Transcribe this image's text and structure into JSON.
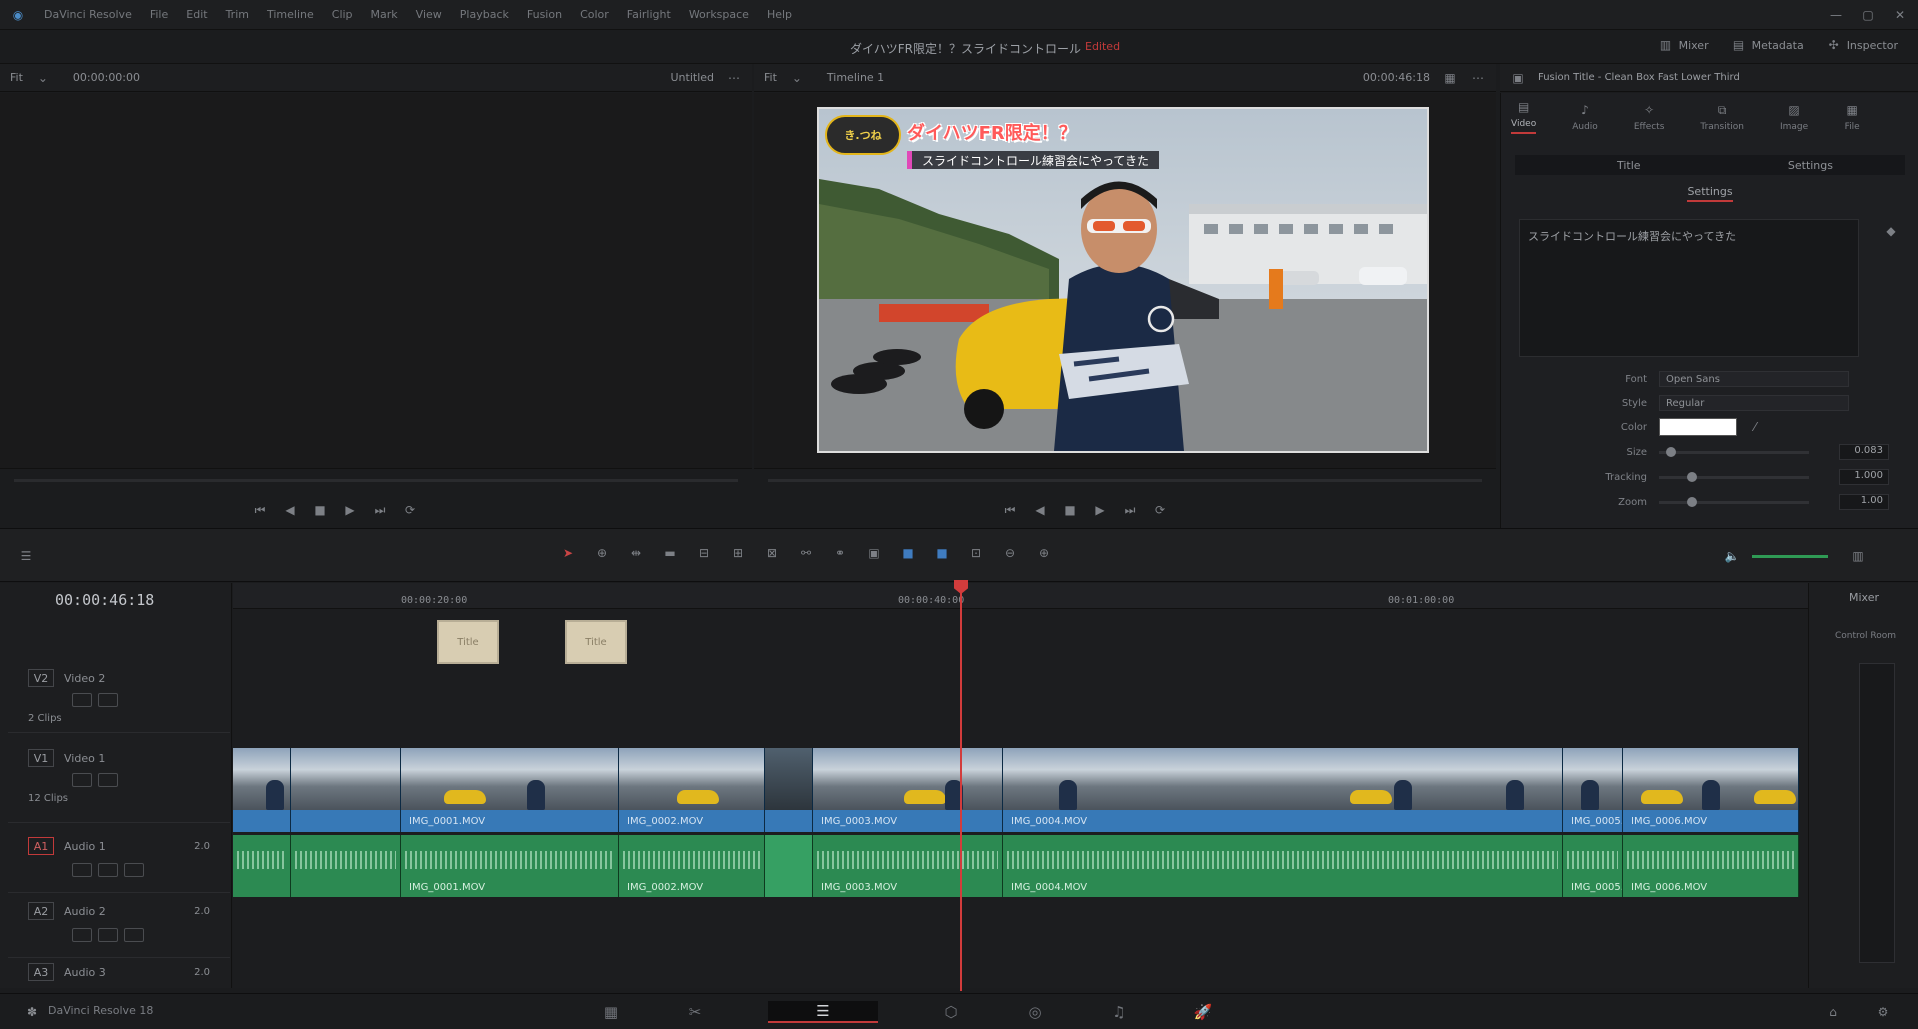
{
  "title_bar": {
    "menus": [
      "DaVinci Resolve",
      "File",
      "Edit",
      "Trim",
      "Timeline",
      "Clip",
      "Mark",
      "View",
      "Playback",
      "Fusion",
      "Color",
      "Fairlight",
      "Workspace",
      "Help"
    ]
  },
  "project": {
    "title": "ダイハツFR限定！？スライドコントロール",
    "status": "Edited"
  },
  "top_right": {
    "mixer": "Mixer",
    "metadata": "Metadata",
    "inspector": "Inspector"
  },
  "source_viewer": {
    "zoom": "Fit",
    "clip_name": "Untitled",
    "timecode": "00:00:00:00"
  },
  "program_viewer": {
    "zoom": "Fit",
    "timeline_name": "Timeline 1",
    "timecode": "00:00:46:18"
  },
  "inspector_header": {
    "title": "Fusion Title - Clean Box Fast Lower Third"
  },
  "video_overlay": {
    "title": "ダイハツFR限定！？",
    "subtitle": "スライドコントロール練習会にやってきた",
    "logo_text": "き.つね"
  },
  "inspector": {
    "tabs": [
      "Video",
      "Audio",
      "Effects",
      "Transition",
      "Image",
      "File"
    ],
    "active_tab": "Video",
    "name_label": "Title",
    "name_right": "Settings",
    "section": "Settings",
    "rich_text": "スライドコントロール練習会にやってきた",
    "props": [
      {
        "label": "Font",
        "value": "Open Sans"
      },
      {
        "label": "Style",
        "value": "Regular"
      },
      {
        "label": "Color",
        "value": ""
      },
      {
        "label": "Size",
        "value": "0.083",
        "level": 0.05
      },
      {
        "label": "Tracking",
        "value": "1.000",
        "level": 0.2
      },
      {
        "label": "Zoom",
        "value": "1.00",
        "level": 0.2
      }
    ]
  },
  "timeline": {
    "timecode": "00:00:46:18",
    "ruler": [
      "00:00:20:00",
      "00:00:40:00",
      "00:01:00:00"
    ],
    "tracks": [
      {
        "id": "V2",
        "name": "Video 2",
        "clips": "2 Clips"
      },
      {
        "id": "V1",
        "name": "Video 1",
        "clips": "12 Clips"
      },
      {
        "id": "A1",
        "name": "Audio 1",
        "channels": "2.0"
      },
      {
        "id": "A2",
        "name": "Audio 2",
        "channels": "2.0"
      },
      {
        "id": "A3",
        "name": "Audio 3",
        "channels": "2.0"
      }
    ],
    "title_clips": [
      "Title",
      "Title"
    ],
    "video_clip_labels": [
      "",
      "",
      "IMG_0001.MOV",
      "IMG_0002.MOV",
      "",
      "IMG_0003.MOV",
      "IMG_0004.MOV",
      "IMG_0005.MOV",
      "",
      "IMG_0006.MOV"
    ],
    "audio_clip_labels": [
      "",
      "",
      "IMG_0001.MOV",
      "IMG_0002.MOV",
      "",
      "IMG_0003.MOV",
      "IMG_0004.MOV",
      "IMG_0005.MOV",
      "",
      "IMG_0006.MOV"
    ]
  },
  "mixer": {
    "title": "Mixer",
    "label": "Control Room"
  },
  "page_bar": {
    "app_name": "DaVinci Resolve 18",
    "pages": [
      "media",
      "cut",
      "edit",
      "fusion",
      "color",
      "fairlight",
      "deliver"
    ],
    "active_page": "edit"
  }
}
